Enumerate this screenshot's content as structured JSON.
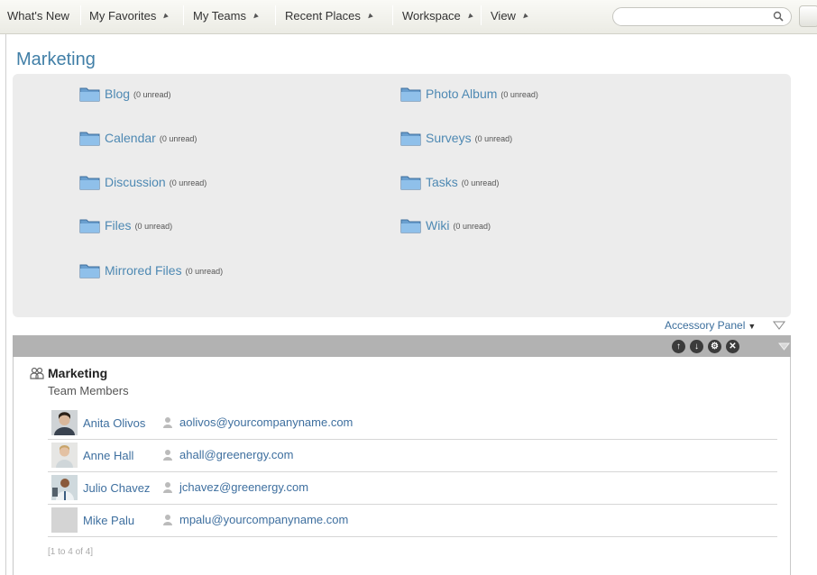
{
  "nav": {
    "items": [
      {
        "label": "What's New",
        "dropdown": false
      },
      {
        "label": "My Favorites",
        "dropdown": true
      },
      {
        "label": "My Teams",
        "dropdown": true
      },
      {
        "label": "Recent Places",
        "dropdown": true
      },
      {
        "label": "Workspace",
        "dropdown": true
      },
      {
        "label": "View",
        "dropdown": true
      }
    ],
    "search_value": "",
    "icons": [
      "search-icon",
      "chevron-down-icon"
    ]
  },
  "page": {
    "title": "Marketing"
  },
  "apps": [
    {
      "name": "Blog",
      "unread": "(0 unread)",
      "icon": "folder-icon"
    },
    {
      "name": "Calendar",
      "unread": "(0 unread)",
      "icon": "folder-icon"
    },
    {
      "name": "Discussion",
      "unread": "(0 unread)",
      "icon": "folder-icon"
    },
    {
      "name": "Files",
      "unread": "(0 unread)",
      "icon": "folder-icon"
    },
    {
      "name": "Mirrored Files",
      "unread": "(0 unread)",
      "icon": "folder-icon"
    },
    {
      "name": "Photo Album",
      "unread": "(0 unread)",
      "icon": "folder-icon"
    },
    {
      "name": "Surveys",
      "unread": "(0 unread)",
      "icon": "folder-icon"
    },
    {
      "name": "Tasks",
      "unread": "(0 unread)",
      "icon": "folder-icon"
    },
    {
      "name": "Wiki",
      "unread": "(0 unread)",
      "icon": "folder-icon"
    }
  ],
  "accessory": {
    "label": "Accessory Panel"
  },
  "widget": {
    "controls": [
      "arrow-up-icon",
      "arrow-down-icon",
      "gear-icon",
      "close-icon",
      "collapse-icon"
    ],
    "team_name": "Marketing",
    "subtitle": "Team Members",
    "members": [
      {
        "name": "Anita Olivos",
        "email": "aolivos@yourcompanyname.com"
      },
      {
        "name": "Anne Hall",
        "email": "ahall@greenergy.com"
      },
      {
        "name": "Julio Chavez",
        "email": "jchavez@greenergy.com"
      },
      {
        "name": "Mike Palu",
        "email": "mpalu@yourcompanyname.com"
      }
    ],
    "pager": "[1 to 4 of 4]"
  },
  "colors": {
    "link": "#4e89b3",
    "title": "#417fa7",
    "panel_bg": "#ececec",
    "widget_bar": "#b2b2b2"
  }
}
